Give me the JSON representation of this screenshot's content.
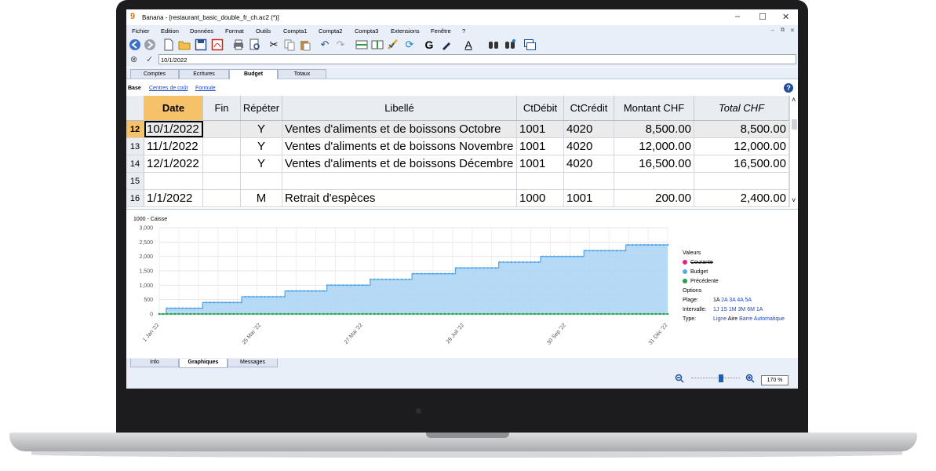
{
  "window": {
    "app_icon": "9",
    "title": "Banana - [restaurant_basic_double_fr_ch.ac2 (*)]",
    "controls": [
      "–",
      "☐",
      "✕"
    ]
  },
  "menu": {
    "items": [
      "Fichier",
      "Edition",
      "Données",
      "Format",
      "Outils",
      "Compta1",
      "Compta2",
      "Compta3",
      "Extensions",
      "Fenêtre",
      "?"
    ],
    "mdi_controls": [
      "–",
      "⧉",
      "✕"
    ]
  },
  "toolbar": {
    "buttons": [
      "back-icon",
      "forward-icon",
      "new-file-icon",
      "open-folder-icon",
      "save-icon",
      "pdf-icon",
      "print-icon",
      "print-preview-icon",
      "cut-icon",
      "copy-icon",
      "paste-icon",
      "undo-icon",
      "redo-icon",
      "add-rows-icon",
      "insert-columns-icon",
      "check-icon",
      "recalculate-icon",
      "bold-icon",
      "highlighter-icon",
      "font-color-icon",
      "find-icon",
      "find-replace-icon",
      "window-icon"
    ],
    "bold_label": "G",
    "font_color_label": "A"
  },
  "editbar": {
    "cancel_icon": "⊗",
    "confirm_icon": "✓",
    "value": "10/1/2022"
  },
  "tabs": [
    {
      "label": "Comptes"
    },
    {
      "label": "Ecritures"
    },
    {
      "label": "Budget",
      "active": true
    },
    {
      "label": "Totaux"
    }
  ],
  "views": {
    "base": "Base",
    "cost_centers": "Centres de coût",
    "formula": "Formule",
    "help_icon": "?"
  },
  "table": {
    "columns": [
      "Date",
      "Fin",
      "Répéter",
      "Libellé",
      "CtDébit",
      "CtCrédit",
      "Montant CHF",
      "Total CHF"
    ],
    "rows": [
      {
        "num": "12",
        "date": "10/1/2022",
        "fin": "",
        "repeat": "Y",
        "label": "Ventes d'aliments et de boissons Octobre",
        "debit": "1001",
        "credit": "4020",
        "amount": "8,500.00",
        "total": "8,500.00"
      },
      {
        "num": "13",
        "date": "11/1/2022",
        "fin": "",
        "repeat": "Y",
        "label": "Ventes d'aliments et de boissons Novembre",
        "debit": "1001",
        "credit": "4020",
        "amount": "12,000.00",
        "total": "12,000.00"
      },
      {
        "num": "14",
        "date": "12/1/2022",
        "fin": "",
        "repeat": "Y",
        "label": "Ventes d'aliments et de boissons Décembre",
        "debit": "1001",
        "credit": "4020",
        "amount": "16,500.00",
        "total": "16,500.00"
      },
      {
        "num": "15",
        "date": "",
        "fin": "",
        "repeat": "",
        "label": "",
        "debit": "",
        "credit": "",
        "amount": "",
        "total": ""
      },
      {
        "num": "16",
        "date": "1/1/2022",
        "fin": "",
        "repeat": "M",
        "label": "Retrait d'espèces",
        "debit": "1000",
        "credit": "1001",
        "amount": "200.00",
        "total": "2,400.00"
      }
    ]
  },
  "chart": {
    "title": "1000 - Caisse",
    "legend_title": "Valeurs",
    "legend": [
      {
        "name": "Courante",
        "color": "#e8207a",
        "struck": true
      },
      {
        "name": "Budget",
        "color": "#5aa9e6",
        "struck": false
      },
      {
        "name": "Précédente",
        "color": "#21a04a",
        "struck": false
      }
    ],
    "options_title": "Options",
    "options": [
      {
        "label": "Plage:",
        "values": [
          "1A",
          "2A",
          "3A",
          "4A",
          "5A"
        ]
      },
      {
        "label": "Intervalle:",
        "values": [
          "1J",
          "1S",
          "1M",
          "3M",
          "6M",
          "1A"
        ]
      },
      {
        "label": "Type:",
        "values": [
          "Ligne",
          "Aire",
          "Barre",
          "Automatique"
        ]
      }
    ]
  },
  "chart_data": {
    "type": "area",
    "title": "1000 - Caisse",
    "x_ticks": [
      "1 Jan '22",
      "25 Mar '22",
      "27 Mai '22",
      "29 Juil '22",
      "30 Sep '22",
      "31 Déc '22"
    ],
    "ylim": [
      0,
      3000
    ],
    "y_ticks": [
      "0",
      "500",
      "1,000",
      "1,500",
      "2,000",
      "2,500",
      "3,000"
    ],
    "grid": true,
    "legend_position": "right",
    "series": [
      {
        "name": "Budget",
        "color": "#5aa9e6",
        "type": "area",
        "steps": [
          {
            "start": "2022-01-01",
            "value": 0
          },
          {
            "start": "2022-01-06",
            "value": 200
          },
          {
            "start": "2022-02-01",
            "value": 400
          },
          {
            "start": "2022-03-01",
            "value": 600
          },
          {
            "start": "2022-04-01",
            "value": 800
          },
          {
            "start": "2022-05-01",
            "value": 1000
          },
          {
            "start": "2022-06-01",
            "value": 1200
          },
          {
            "start": "2022-07-01",
            "value": 1400
          },
          {
            "start": "2022-08-01",
            "value": 1600
          },
          {
            "start": "2022-09-01",
            "value": 1800
          },
          {
            "start": "2022-10-01",
            "value": 2000
          },
          {
            "start": "2022-11-01",
            "value": 2200
          },
          {
            "start": "2022-12-01",
            "value": 2400
          }
        ],
        "end": "2022-12-31"
      },
      {
        "name": "Précédente",
        "color": "#21a04a",
        "type": "line",
        "steps": [
          {
            "start": "2022-01-01",
            "value": 0
          }
        ],
        "end": "2022-12-31"
      }
    ]
  },
  "bottom_tabs": [
    {
      "label": "Info"
    },
    {
      "label": "Graphiques",
      "active": true
    },
    {
      "label": "Messages"
    }
  ],
  "status": {
    "zoom_value": "170 %",
    "zoom_slider": 0.62
  }
}
